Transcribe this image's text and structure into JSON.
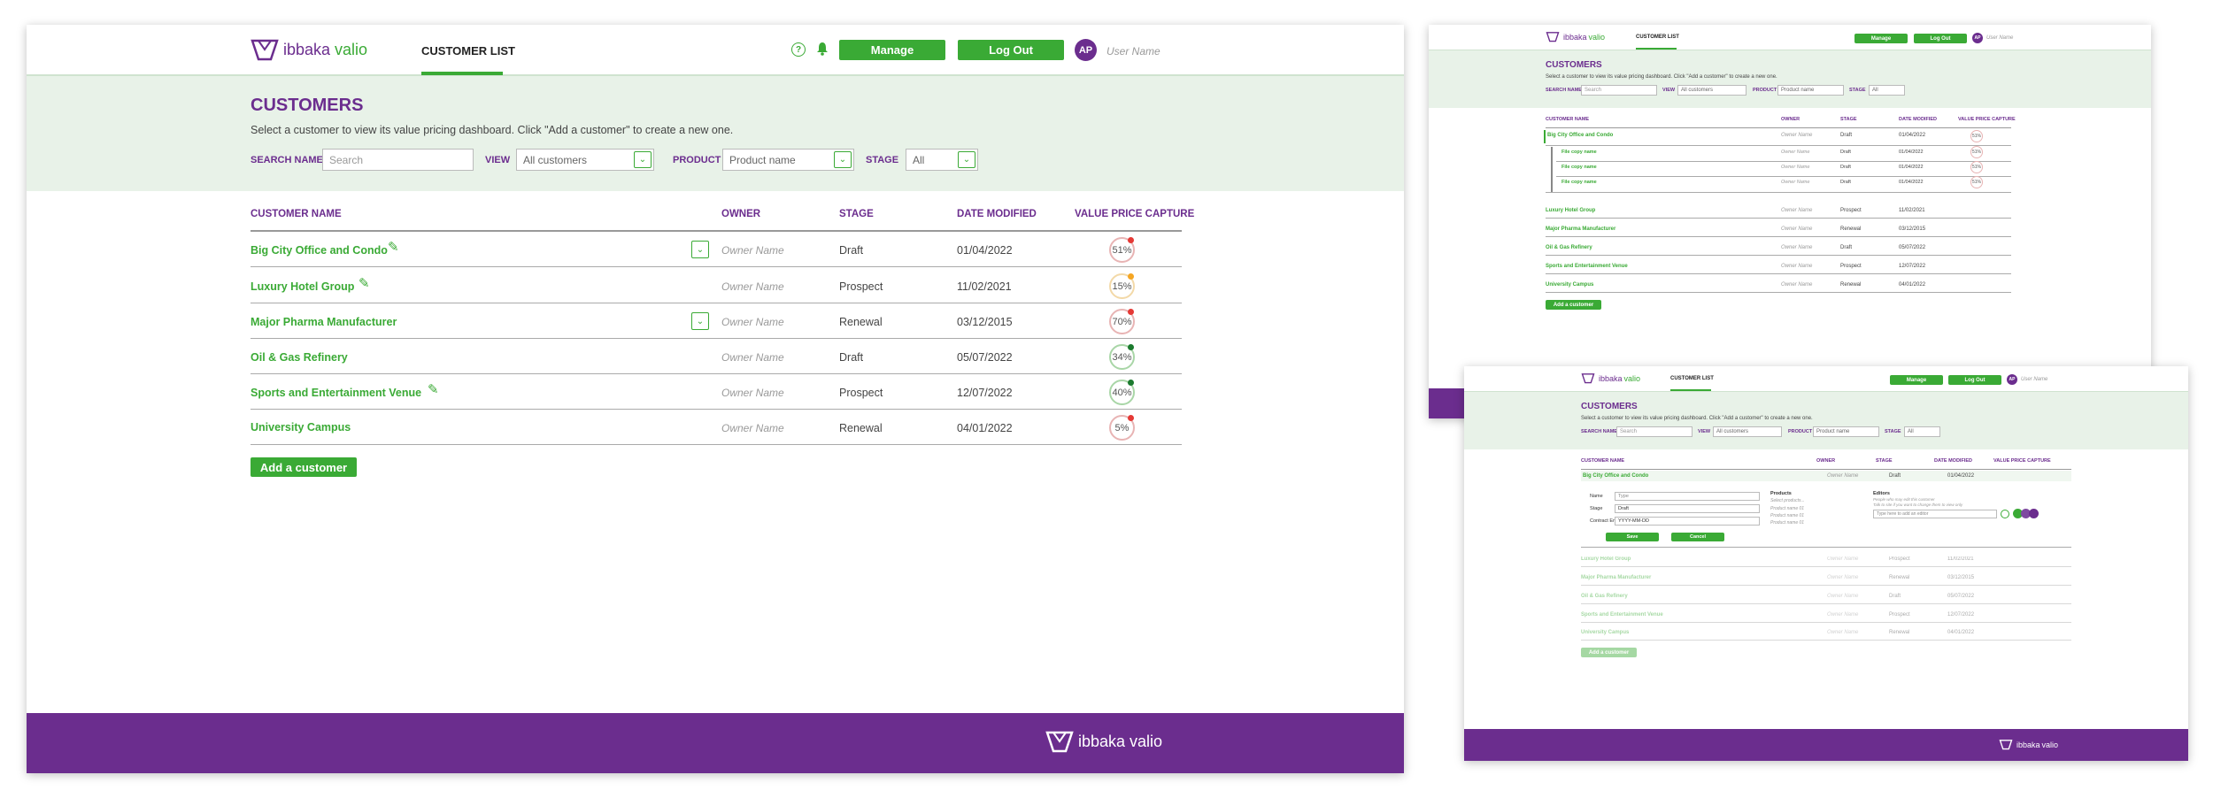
{
  "brand": {
    "name_part1": "ibbaka",
    "name_part2": "valio"
  },
  "header": {
    "nav_tab": "CUSTOMER LIST",
    "manage_label": "Manage",
    "logout_label": "Log Out",
    "avatar_initials": "AP",
    "user_name": "User Name"
  },
  "page": {
    "title": "CUSTOMERS",
    "subtitle": "Select a customer to view its value pricing dashboard. Click \"Add a customer\" to create a new one."
  },
  "filters": {
    "search_label": "SEARCH NAME",
    "search_placeholder": "Search",
    "view_label": "VIEW",
    "view_value": "All customers",
    "product_label": "PRODUCT",
    "product_value": "Product name",
    "stage_label": "STAGE",
    "stage_value": "All"
  },
  "table": {
    "headers": [
      "CUSTOMER NAME",
      "OWNER",
      "STAGE",
      "DATE MODIFIED",
      "VALUE PRICE CAPTURE"
    ],
    "rows": [
      {
        "name": "Big City Office and Condo",
        "owner": "Owner Name",
        "stage": "Draft",
        "date": "01/04/2022",
        "capture": "51%",
        "dot": "#e53935"
      },
      {
        "name": "Luxury Hotel Group",
        "owner": "Owner Name",
        "stage": "Prospect",
        "date": "11/02/2021",
        "capture": "15%",
        "dot": "#f5a623"
      },
      {
        "name": "Major Pharma Manufacturer",
        "owner": "Owner Name",
        "stage": "Renewal",
        "date": "03/12/2015",
        "capture": "70%",
        "dot": "#e53935"
      },
      {
        "name": "Oil & Gas Refinery",
        "owner": "Owner Name",
        "stage": "Draft",
        "date": "05/07/2022",
        "capture": "34%",
        "dot": "#1b7a2e"
      },
      {
        "name": "Sports and Entertainment Venue",
        "owner": "Owner Name",
        "stage": "Prospect",
        "date": "12/07/2022",
        "capture": "40%",
        "dot": "#1b7a2e"
      },
      {
        "name": "University Campus",
        "owner": "Owner Name",
        "stage": "Renewal",
        "date": "04/01/2022",
        "capture": "5%",
        "dot": "#e53935"
      }
    ]
  },
  "add_customer_label": "Add a customer",
  "expanded_view": {
    "sub_items": [
      {
        "name": "File copy name",
        "owner": "Owner Name",
        "stage": "Draft",
        "date": "01/04/2022",
        "capture": "51%"
      },
      {
        "name": "File copy name",
        "owner": "Owner Name",
        "stage": "Draft",
        "date": "01/04/2022",
        "capture": "51%"
      },
      {
        "name": "File copy name",
        "owner": "Owner Name",
        "stage": "Draft",
        "date": "01/04/2022",
        "capture": "51%"
      }
    ]
  },
  "edit_form": {
    "name_label": "Name",
    "name_placeholder": "Type",
    "stage_label": "Stage",
    "stage_value": "Draft",
    "contract_label": "Contract End",
    "contract_value": "YYYY-MM-DD",
    "products_label": "Products",
    "products_hint": "Select products...",
    "product_items": [
      "Product name 01",
      "Product name 01",
      "Product name 01"
    ],
    "editors_label": "Editors",
    "editors_hint1": "People who may edit this customer",
    "editors_hint2": "Talk to site if you want to change them to view only",
    "editors_input": "Type here to add an editor",
    "save_label": "Save",
    "cancel_label": "Cancel"
  },
  "colors": {
    "purple": "#6b2d8e",
    "green": "#3aaa35",
    "band": "#e8f2e8"
  }
}
